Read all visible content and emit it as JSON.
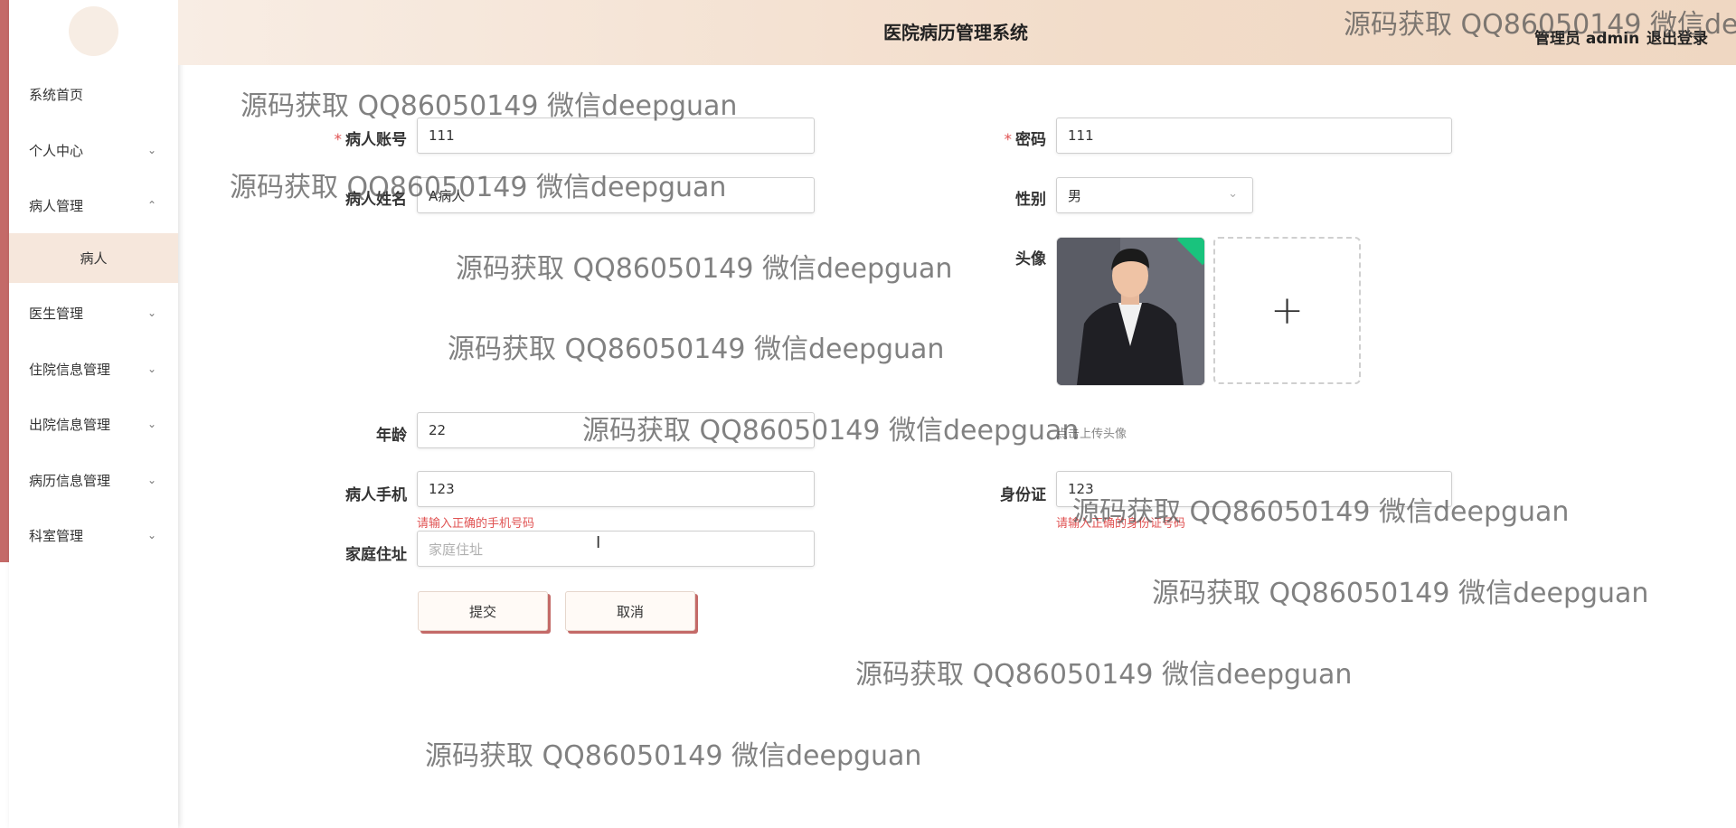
{
  "header": {
    "title": "医院病历管理系统",
    "user": "管理员 admin",
    "logout": "退出登录"
  },
  "sidebar": {
    "items": [
      {
        "label": "系统首页",
        "chevron": ""
      },
      {
        "label": "个人中心",
        "chevron": "⌄"
      },
      {
        "label": "病人管理",
        "chevron": "⌃"
      },
      {
        "label": "医生管理",
        "chevron": "⌄"
      },
      {
        "label": "住院信息管理",
        "chevron": "⌄"
      },
      {
        "label": "出院信息管理",
        "chevron": "⌄"
      },
      {
        "label": "病历信息管理",
        "chevron": "⌄"
      },
      {
        "label": "科室管理",
        "chevron": "⌄"
      }
    ],
    "sub_active": "病人"
  },
  "form": {
    "account_label": "病人账号",
    "account_value": "111",
    "password_label": "密码",
    "password_value": "111",
    "name_label": "病人姓名",
    "name_value": "A病人",
    "gender_label": "性别",
    "gender_value": "男",
    "avatar_label": "头像",
    "avatar_hint": "点击上传头像",
    "age_label": "年龄",
    "age_value": "22",
    "phone_label": "病人手机",
    "phone_value": "123",
    "phone_error": "请输入正确的手机号码",
    "idcard_label": "身份证",
    "idcard_value": "123",
    "idcard_error": "请输入正确的身份证号码",
    "address_label": "家庭住址",
    "address_placeholder": "家庭住址",
    "submit": "提交",
    "cancel": "取消"
  },
  "watermark": "源码获取 QQ86050149 微信deepguan",
  "colors": {
    "accent": "#c46a68",
    "header_bg": "#f2dcc9",
    "submenu_bg": "#f6e7dc",
    "error": "#e05353"
  }
}
